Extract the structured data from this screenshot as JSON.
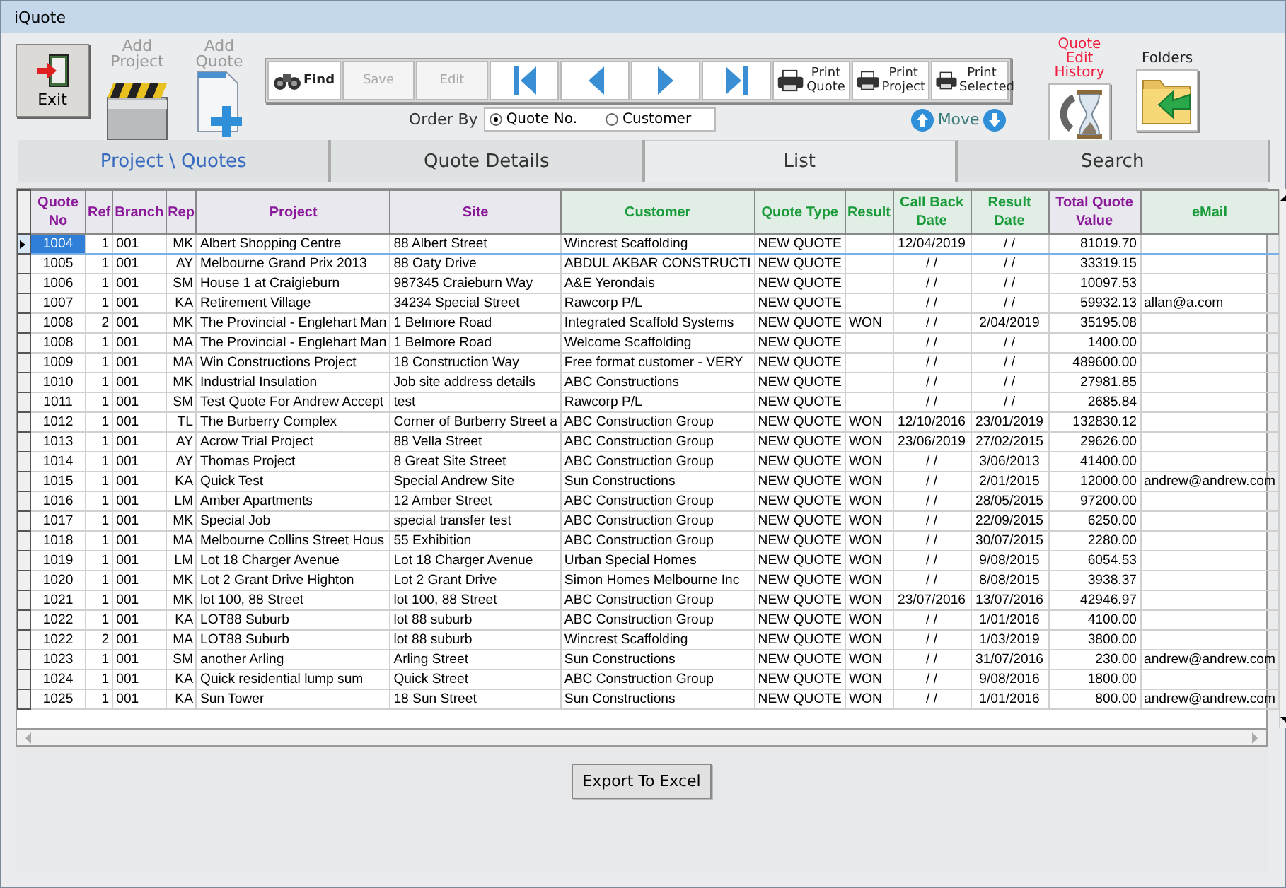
{
  "window": {
    "title": "iQuote"
  },
  "toolbar": {
    "exit": {
      "label": "Exit"
    },
    "add_project": {
      "label": "Add Project",
      "disabled": true
    },
    "add_quote": {
      "label": "Add Quote",
      "disabled": true
    },
    "buttons": [
      {
        "kind": "find",
        "label": "Find",
        "disabled": false
      },
      {
        "kind": "save",
        "label": "Save",
        "disabled": true
      },
      {
        "kind": "edit",
        "label": "Edit",
        "disabled": true
      },
      {
        "kind": "first",
        "disabled": false
      },
      {
        "kind": "previous",
        "disabled": false
      },
      {
        "kind": "next",
        "disabled": false
      },
      {
        "kind": "last",
        "disabled": false
      },
      {
        "kind": "print",
        "label": "Print Quote",
        "disabled": false
      },
      {
        "kind": "print",
        "label": "Print Project",
        "disabled": false
      },
      {
        "kind": "print",
        "label": "Print Selected",
        "disabled": false
      }
    ],
    "order_by": {
      "label": "Order By",
      "options": [
        {
          "label": "Quote No.",
          "selected": true
        },
        {
          "label": "Customer",
          "selected": false
        }
      ]
    },
    "move": {
      "label": "Move"
    },
    "quote_edit_history": {
      "label": "Quote Edit History"
    },
    "folders": {
      "label": "Folders"
    }
  },
  "tabs": [
    {
      "label": "Project \\ Quotes",
      "selected": false
    },
    {
      "label": "Quote Details",
      "selected": false
    },
    {
      "label": "List",
      "selected": true
    },
    {
      "label": "Search",
      "selected": false
    }
  ],
  "table": {
    "columns": [
      {
        "label": "Quote No",
        "color": "#8b1a9b"
      },
      {
        "label": "Ref",
        "color": "#8b1a9b"
      },
      {
        "label": "Branch",
        "color": "#8b1a9b"
      },
      {
        "label": "Rep",
        "color": "#8b1a9b"
      },
      {
        "label": "Project",
        "color": "#8b1a9b"
      },
      {
        "label": "Site",
        "color": "#8b1a9b"
      },
      {
        "label": "Customer",
        "color": "#1a9b3a"
      },
      {
        "label": "Quote Type",
        "color": "#1a9b3a"
      },
      {
        "label": "Result",
        "color": "#1a9b3a"
      },
      {
        "label": "Call Back Date",
        "color": "#1a9b3a"
      },
      {
        "label": "Result Date",
        "color": "#1a9b3a"
      },
      {
        "label": "Total Quote Value",
        "color": "#8b1a9b"
      },
      {
        "label": "eMail",
        "color": "#1a9b3a"
      }
    ],
    "rows": [
      {
        "selected": true,
        "cells": [
          "1004",
          "1",
          "001",
          "MK",
          "Albert Shopping Centre",
          "88 Albert Street",
          "Wincrest Scaffolding",
          "NEW QUOTE",
          "",
          "12/04/2019",
          "/ /",
          "81019.70",
          ""
        ]
      },
      {
        "selected": false,
        "cells": [
          "1005",
          "1",
          "001",
          "AY",
          "Melbourne Grand Prix 2013",
          "88 Oaty Drive",
          "ABDUL AKBAR CONSTRUCTI",
          "NEW QUOTE",
          "",
          "/ /",
          "/ /",
          "33319.15",
          ""
        ]
      },
      {
        "selected": false,
        "cells": [
          "1006",
          "1",
          "001",
          "SM",
          "House 1 at Craigieburn",
          "987345 Craieburn Way",
          "A&E Yerondais",
          "NEW QUOTE",
          "",
          "/ /",
          "/ /",
          "10097.53",
          ""
        ]
      },
      {
        "selected": false,
        "cells": [
          "1007",
          "1",
          "001",
          "KA",
          "Retirement Village",
          "34234 Special Street",
          "Rawcorp P/L",
          "NEW QUOTE",
          "",
          "/ /",
          "/ /",
          "59932.13",
          "allan@a.com"
        ]
      },
      {
        "selected": false,
        "cells": [
          "1008",
          "2",
          "001",
          "MK",
          "The Provincial - Englehart Man",
          "1 Belmore Road",
          "Integrated Scaffold Systems",
          "NEW QUOTE",
          "WON",
          "/ /",
          "2/04/2019",
          "35195.08",
          ""
        ]
      },
      {
        "selected": false,
        "cells": [
          "1008",
          "1",
          "001",
          "MA",
          "The Provincial - Englehart Man",
          "1 Belmore Road",
          "Welcome Scaffolding",
          "NEW QUOTE",
          "",
          "/ /",
          "/ /",
          "1400.00",
          ""
        ]
      },
      {
        "selected": false,
        "cells": [
          "1009",
          "1",
          "001",
          "MA",
          "Win Constructions Project",
          "18 Construction Way",
          "Free format customer - VERY",
          "NEW QUOTE",
          "",
          "/ /",
          "/ /",
          "489600.00",
          ""
        ]
      },
      {
        "selected": false,
        "cells": [
          "1010",
          "1",
          "001",
          "MK",
          "Industrial Insulation",
          "Job site address details",
          "ABC Constructions",
          "NEW QUOTE",
          "",
          "/ /",
          "/ /",
          "27981.85",
          ""
        ]
      },
      {
        "selected": false,
        "cells": [
          "1011",
          "1",
          "001",
          "SM",
          "Test Quote For Andrew Accept",
          "test",
          "Rawcorp P/L",
          "NEW QUOTE",
          "",
          "/ /",
          "/ /",
          "2685.84",
          ""
        ]
      },
      {
        "selected": false,
        "cells": [
          "1012",
          "1",
          "001",
          "TL",
          "The Burberry Complex",
          "Corner of Burberry Street a",
          "ABC Construction Group",
          "NEW QUOTE",
          "WON",
          "12/10/2016",
          "23/01/2019",
          "132830.12",
          ""
        ]
      },
      {
        "selected": false,
        "cells": [
          "1013",
          "1",
          "001",
          "AY",
          "Acrow Trial Project",
          "88 Vella Street",
          "ABC Construction Group",
          "NEW QUOTE",
          "WON",
          "23/06/2019",
          "27/02/2015",
          "29626.00",
          ""
        ]
      },
      {
        "selected": false,
        "cells": [
          "1014",
          "1",
          "001",
          "AY",
          "Thomas Project",
          "8 Great Site Street",
          "ABC Construction Group",
          "NEW QUOTE",
          "WON",
          "/ /",
          "3/06/2013",
          "41400.00",
          ""
        ]
      },
      {
        "selected": false,
        "cells": [
          "1015",
          "1",
          "001",
          "KA",
          "Quick Test",
          "Special Andrew Site",
          "Sun Constructions",
          "NEW QUOTE",
          "WON",
          "/ /",
          "2/01/2015",
          "12000.00",
          "andrew@andrew.com"
        ]
      },
      {
        "selected": false,
        "cells": [
          "1016",
          "1",
          "001",
          "LM",
          "Amber Apartments",
          "12 Amber Street",
          "ABC Construction Group",
          "NEW QUOTE",
          "WON",
          "/ /",
          "28/05/2015",
          "97200.00",
          ""
        ]
      },
      {
        "selected": false,
        "cells": [
          "1017",
          "1",
          "001",
          "MK",
          "Special Job",
          "special transfer test",
          "ABC Construction Group",
          "NEW QUOTE",
          "WON",
          "/ /",
          "22/09/2015",
          "6250.00",
          ""
        ]
      },
      {
        "selected": false,
        "cells": [
          "1018",
          "1",
          "001",
          "MA",
          "Melbourne Collins Street Hous",
          "55 Exhibition",
          "ABC Construction Group",
          "NEW QUOTE",
          "WON",
          "/ /",
          "30/07/2015",
          "2280.00",
          ""
        ]
      },
      {
        "selected": false,
        "cells": [
          "1019",
          "1",
          "001",
          "LM",
          "Lot 18 Charger Avenue",
          "Lot 18 Charger Avenue",
          "Urban Special Homes",
          "NEW QUOTE",
          "WON",
          "/ /",
          "9/08/2015",
          "6054.53",
          ""
        ]
      },
      {
        "selected": false,
        "cells": [
          "1020",
          "1",
          "001",
          "MK",
          "Lot 2 Grant Drive Highton",
          "Lot 2 Grant Drive",
          "Simon Homes Melbourne Inc",
          "NEW QUOTE",
          "WON",
          "/ /",
          "8/08/2015",
          "3938.37",
          ""
        ]
      },
      {
        "selected": false,
        "cells": [
          "1021",
          "1",
          "001",
          "MK",
          "lot 100, 88 Street",
          "lot 100, 88 Street",
          "ABC Construction Group",
          "NEW QUOTE",
          "WON",
          "23/07/2016",
          "13/07/2016",
          "42946.97",
          ""
        ]
      },
      {
        "selected": false,
        "cells": [
          "1022",
          "1",
          "001",
          "KA",
          "LOT88 Suburb",
          "lot 88 suburb",
          "ABC Construction Group",
          "NEW QUOTE",
          "WON",
          "/ /",
          "1/01/2016",
          "4100.00",
          ""
        ]
      },
      {
        "selected": false,
        "cells": [
          "1022",
          "2",
          "001",
          "MA",
          "LOT88 Suburb",
          "lot 88 suburb",
          "Wincrest Scaffolding",
          "NEW QUOTE",
          "WON",
          "/ /",
          "1/03/2019",
          "3800.00",
          ""
        ]
      },
      {
        "selected": false,
        "cells": [
          "1023",
          "1",
          "001",
          "SM",
          "another Arling",
          "Arling Street",
          "Sun Constructions",
          "NEW QUOTE",
          "WON",
          "/ /",
          "31/07/2016",
          "230.00",
          "andrew@andrew.com"
        ]
      },
      {
        "selected": false,
        "cells": [
          "1024",
          "1",
          "001",
          "KA",
          "Quick residential lump sum",
          "Quick Street",
          "ABC Construction Group",
          "NEW QUOTE",
          "WON",
          "/ /",
          "9/08/2016",
          "1800.00",
          ""
        ]
      },
      {
        "selected": false,
        "cells": [
          "1025",
          "1",
          "001",
          "KA",
          "Sun Tower",
          "18 Sun Street",
          "Sun Constructions",
          "NEW QUOTE",
          "WON",
          "/ /",
          "1/01/2016",
          "800.00",
          "andrew@andrew.com"
        ]
      }
    ]
  },
  "export_button": {
    "label": "Export To Excel"
  }
}
